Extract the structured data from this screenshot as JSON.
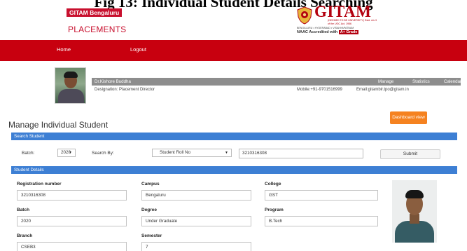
{
  "caption": "Fig 13: Individual Student Details Searching",
  "header": {
    "badge": "GITAM Bengaluru",
    "placements": "PLACEMENTS",
    "logo_word": "GITAM",
    "logo_sub": "(DEEMED TO BE UNIVERSITY) Estd. u/s 3 of the UGC Act, 1956",
    "logo_locations": "BENGALURU • HYDERABAD • VISAKHAPATNAM",
    "naac_text": "NAAC Accredited with",
    "naac_grade": "A+ Grade"
  },
  "nav": {
    "home": "Home",
    "logout": "Logout"
  },
  "profile": {
    "name": "Dr.Kishore Buddha",
    "menu": [
      "Manage",
      "Statistics",
      "Calendar"
    ],
    "designation": "Designation: Placement Director",
    "mobile": "Mobile:+91-9701516999",
    "email": "Email:gitambir.tpo@gitam.in"
  },
  "page": {
    "title": "Manage Individual Student",
    "dashboard_button": "Dashboard view"
  },
  "search": {
    "section_title": "Search Student",
    "batch_label": "Batch:",
    "batch_value": "2020",
    "search_by_label": "Search By:",
    "search_by_value": "Student Roll No",
    "query_value": "3210316308",
    "submit_label": "Submit"
  },
  "details": {
    "section_title": "Student Details",
    "fields": {
      "registration_label": "Registration number",
      "registration_value": "3210316308",
      "campus_label": "Campus",
      "campus_value": "Bengaluru",
      "college_label": "College",
      "college_value": "GST",
      "batch_label": "Batch",
      "batch_value": "2020",
      "degree_label": "Degree",
      "degree_value": "Under Graduate",
      "program_label": "Program",
      "program_value": "B.Tech",
      "branch_label": "Branch",
      "branch_value": "CSEB3",
      "semester_label": "Semester",
      "semester_value": "7"
    }
  },
  "colors": {
    "brand_red": "#c8000f",
    "section_blue": "#3d7fd4",
    "accent_orange": "#f58220",
    "info_bar_gray": "#8d8d8d"
  }
}
